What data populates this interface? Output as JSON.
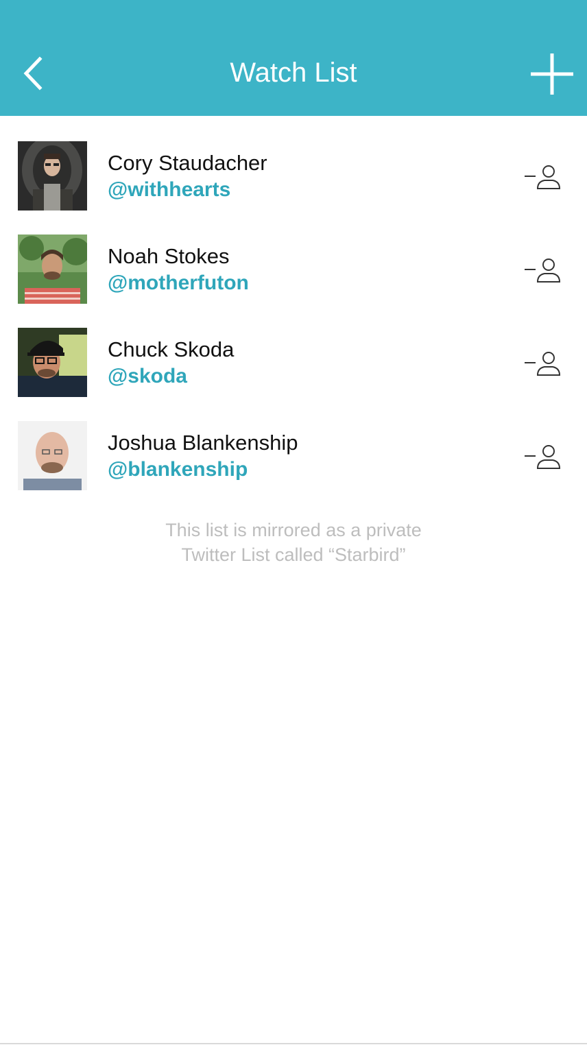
{
  "nav": {
    "title": "Watch List",
    "back_icon": "chevron-left-icon",
    "add_icon": "plus-icon",
    "background": "#3db4c7"
  },
  "watch_list": [
    {
      "name": "Cory Staudacher",
      "handle": "@withhearts",
      "avatar_icon": "avatar-photo"
    },
    {
      "name": "Noah Stokes",
      "handle": "@motherfuton",
      "avatar_icon": "avatar-photo"
    },
    {
      "name": "Chuck Skoda",
      "handle": "@skoda",
      "avatar_icon": "avatar-photo"
    },
    {
      "name": "Joshua Blankenship",
      "handle": "@blankenship",
      "avatar_icon": "avatar-photo"
    }
  ],
  "footer": {
    "line1": "This list is mirrored as a private",
    "line2": "Twitter List called “Starbird”"
  },
  "colors": {
    "accent": "#3db4c7",
    "handle": "#2fa6ba",
    "note": "#bdbdbd"
  }
}
